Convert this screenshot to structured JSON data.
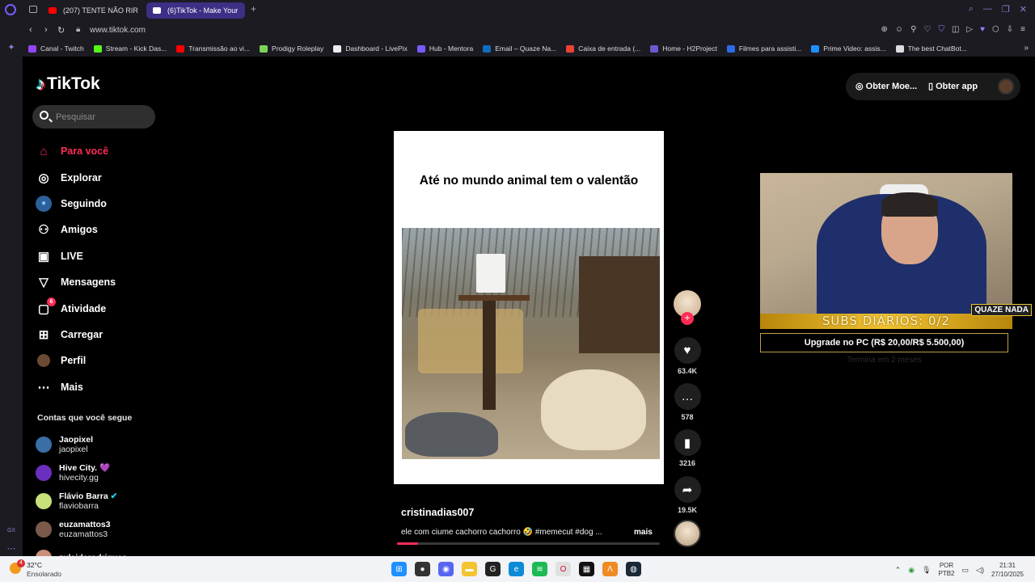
{
  "browser": {
    "tabs": [
      {
        "label": "(207) TENTE NÃO RIR 😂",
        "fav_color": "#ff0000"
      },
      {
        "label": "(6)TikTok - Make Your",
        "fav_color": "#ffffff",
        "active": true
      }
    ],
    "url": "www.tiktok.com",
    "bookmarks": [
      {
        "label": "Canal - Twitch",
        "color": "#9146ff"
      },
      {
        "label": "Stream - Kick Das...",
        "color": "#53fc18"
      },
      {
        "label": "Transmissão ao vi...",
        "color": "#ff0000"
      },
      {
        "label": "Prodigy Roleplay",
        "color": "#7dd35a"
      },
      {
        "label": "Dashboard - LivePix",
        "color": "#eeeeee"
      },
      {
        "label": "Hub - Mentora",
        "color": "#7b5bff"
      },
      {
        "label": "Email – Quaze Na...",
        "color": "#0f6cbd"
      },
      {
        "label": "Caixa de entrada (...",
        "color": "#ea4335"
      },
      {
        "label": "Home - H2Project",
        "color": "#6a5acd"
      },
      {
        "label": "Filmes para assisti...",
        "color": "#2b6be6"
      },
      {
        "label": "Prime Video: assis...",
        "color": "#1f8fff"
      },
      {
        "label": "The best ChatBot...",
        "color": "#dddddd"
      }
    ]
  },
  "tiktok": {
    "logo": "TikTok",
    "search_placeholder": "Pesquisar",
    "nav": [
      {
        "label": "Para você",
        "icon": "home-icon",
        "glyph": "⌂",
        "active": true
      },
      {
        "label": "Explorar",
        "icon": "compass-icon",
        "glyph": "◎"
      },
      {
        "label": "Seguindo",
        "icon": "following-avatar-icon",
        "glyph": "●"
      },
      {
        "label": "Amigos",
        "icon": "friends-icon",
        "glyph": "⚇"
      },
      {
        "label": "LIVE",
        "icon": "live-icon",
        "glyph": "▣"
      },
      {
        "label": "Mensagens",
        "icon": "messages-icon",
        "glyph": "▽"
      },
      {
        "label": "Atividade",
        "icon": "activity-icon",
        "glyph": "▢",
        "badge": "6"
      },
      {
        "label": "Carregar",
        "icon": "upload-icon",
        "glyph": "⊞"
      },
      {
        "label": "Perfil",
        "icon": "profile-icon",
        "glyph": "●"
      },
      {
        "label": "Mais",
        "icon": "more-icon",
        "glyph": "⋯"
      }
    ],
    "following_title": "Contas que você segue",
    "following": [
      {
        "name": "Jaopixel",
        "handle": "jaopixel",
        "color": "#3a6ea5"
      },
      {
        "name": "Hive City. 💜",
        "handle": "hivecity.gg",
        "color": "#6b2fbf"
      },
      {
        "name": "Flávio Barra",
        "handle": "flaviobarra",
        "color": "#c7e07a",
        "verified": true
      },
      {
        "name": "euzamattos3",
        "handle": "euzamattos3",
        "color": "#7a5a4a"
      },
      {
        "name": "zuleiderodrigues...",
        "handle": "",
        "color": "#c98f7a"
      }
    ],
    "top_right": {
      "coins": "Obter Moe...",
      "app": "Obter app"
    },
    "video": {
      "overlay_text": "Até no mundo animal tem o valentão",
      "username": "cristinadias007",
      "description": "ele com ciume cachorro cachorro 🤣 #memecut #dog ...",
      "more": "mais",
      "progress": 0.08
    },
    "actions": {
      "likes": "63.4K",
      "comments": "578",
      "saves": "3216",
      "shares": "19.5K"
    }
  },
  "stream_overlay": {
    "subs_text": "SUBS DIÁRIOS: 0/2",
    "logo_text": "QUAZE NADA",
    "upgrade_text": "Upgrade no PC (R$ 20,00/R$ 5.500,00)",
    "ends_text": "Termina em 2 meses"
  },
  "taskbar": {
    "weather_badge": "4",
    "temperature": "32°C",
    "weather": "Ensolarado",
    "lang_top": "POR",
    "lang_bottom": "PTB2",
    "time": "21:31",
    "date": "27/10/2025",
    "apps": [
      {
        "name": "windows-start-icon",
        "color": "#1e90ff",
        "glyph": "⊞"
      },
      {
        "name": "chrome-dev-icon",
        "color": "#333333",
        "glyph": "●"
      },
      {
        "name": "discord-icon",
        "color": "#5865f2",
        "glyph": "◉"
      },
      {
        "name": "file-explorer-icon",
        "color": "#f4c430",
        "glyph": "▬"
      },
      {
        "name": "github-icon",
        "color": "#222222",
        "glyph": "G"
      },
      {
        "name": "edge-icon",
        "color": "#0c8bd6",
        "glyph": "e"
      },
      {
        "name": "spotify-icon",
        "color": "#1db954",
        "glyph": "≋"
      },
      {
        "name": "opera-icon",
        "color": "#e0e0e0",
        "glyph": "O"
      },
      {
        "name": "obs-cinema-icon",
        "color": "#111111",
        "glyph": "▦"
      },
      {
        "name": "app-icon",
        "color": "#f08a24",
        "glyph": "Λ"
      },
      {
        "name": "steam-icon",
        "color": "#1b2838",
        "glyph": "◍"
      }
    ]
  }
}
